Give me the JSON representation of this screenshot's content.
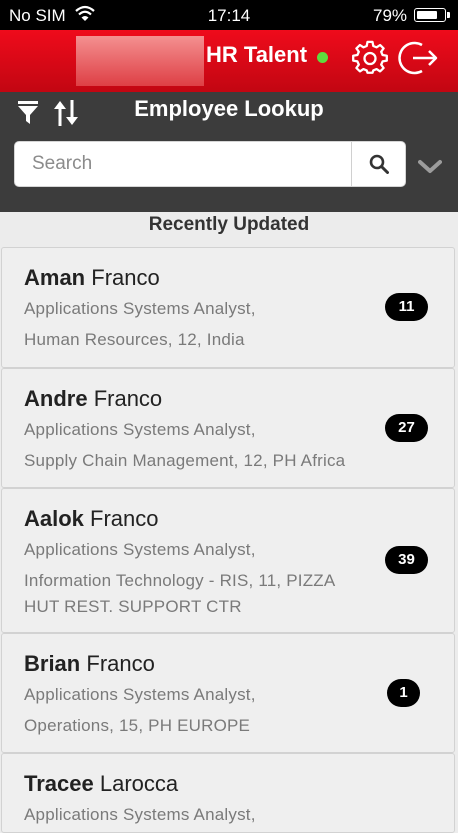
{
  "status_bar": {
    "carrier": "No SIM",
    "time": "17:14",
    "battery_percent": "79%",
    "battery_level": 0.79
  },
  "header": {
    "app_title": "HR Talent",
    "online_color": "#5fdb3e",
    "brand_color": "#e0091a"
  },
  "toolbar": {
    "title": "Employee Lookup",
    "search_placeholder": "Search"
  },
  "section": {
    "title": "Recently Updated"
  },
  "employees": [
    {
      "first": "Aman",
      "last": "Franco",
      "line1": "Applications Systems Analyst,",
      "line2": "Human Resources, 12, India",
      "line3": "",
      "count": "11"
    },
    {
      "first": "Andre",
      "last": "Franco",
      "line1": "Applications Systems Analyst,",
      "line2": "Supply Chain Management, 12, PH Africa",
      "line3": "",
      "count": "27"
    },
    {
      "first": "Aalok",
      "last": "Franco",
      "line1": "Applications Systems Analyst,",
      "line2": "Information Technology - RIS, 11, PIZZA",
      "line3": "HUT REST. SUPPORT CTR",
      "count": "39"
    },
    {
      "first": "Brian",
      "last": "Franco",
      "line1": "Applications Systems Analyst,",
      "line2": "Operations, 15, PH EUROPE",
      "line3": "",
      "count": "1"
    },
    {
      "first": "Tracee",
      "last": "Larocca",
      "line1": "Applications Systems Analyst,",
      "line2": "",
      "line3": "",
      "count": ""
    }
  ]
}
